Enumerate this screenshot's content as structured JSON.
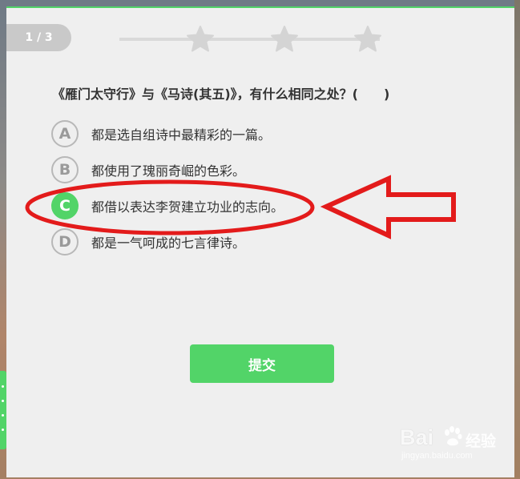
{
  "quiz": {
    "progress": "1 / 3",
    "question": "《雁门太守行》与《马诗(其五)》，有什么相同之处？(　　)",
    "options": [
      {
        "letter": "A",
        "text": "都是选自组诗中最精彩的一篇。"
      },
      {
        "letter": "B",
        "text": "都使用了瑰丽奇崛的色彩。"
      },
      {
        "letter": "C",
        "text": "都借以表达李贺建立功业的志向。"
      },
      {
        "letter": "D",
        "text": "都是一气呵成的七言律诗。"
      }
    ],
    "selected": "C",
    "submit_label": "提交"
  },
  "watermark": {
    "brand": "Bai",
    "brand_suffix": "经验",
    "url": "jingyan.baidu.com"
  },
  "colors": {
    "accent": "#52d468",
    "annotation": "#e31b1b",
    "card_bg": "#efefef"
  },
  "icons": [
    "star-icon",
    "arrow-annotation-icon",
    "paw-icon"
  ]
}
